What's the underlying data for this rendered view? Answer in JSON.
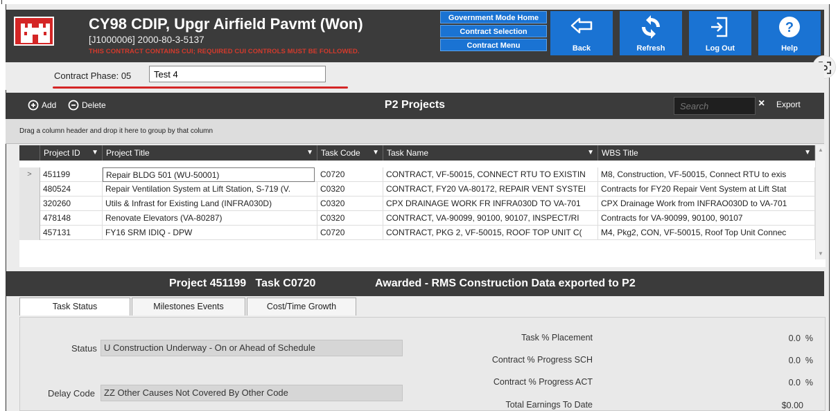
{
  "header": {
    "title": "CY98 CDIP, Upgr Airfield Pavmt (Won)",
    "subtitle": "[J1000006] 2000-80-3-5137",
    "cui_notice": "THIS CONTRACT CONTAINS CUI; REQUIRED CUI CONTROLS MUST BE FOLLOWED.",
    "nav_links": [
      "Government Mode Home",
      "Contract Selection",
      "Contract Menu"
    ],
    "buttons": {
      "back": "Back",
      "refresh": "Refresh",
      "logout": "Log Out",
      "help": "Help"
    },
    "colors": {
      "bg": "#3b3b3b",
      "button": "#1a73d3",
      "logo": "#d42626",
      "cui": "#d33a2c"
    }
  },
  "phase": {
    "label": "Contract Phase: 05",
    "input_value": "Test 4"
  },
  "toolbar": {
    "add": "Add",
    "delete": "Delete",
    "title": "P2 Projects",
    "search_placeholder": "Search",
    "clear": "×",
    "export": "Export"
  },
  "group_hint": "Drag a column header and drop it here to group by that column",
  "grid": {
    "columns": [
      "Project ID",
      "Project Title",
      "Task Code",
      "Task Name",
      "WBS Title"
    ],
    "rows": [
      {
        "id": "451199",
        "title": "Repair BLDG 501 (WU-50001)",
        "code": "C0720",
        "task": "CONTRACT, VF-50015, CONNECT RTU TO EXISTIN",
        "wbs": "M8, Construction, VF-50015, Connect RTU to exis",
        "selector": ">"
      },
      {
        "id": "480524",
        "title": "Repair Ventilation System at Lift Station, S-719 (V.",
        "code": "C0320",
        "task": "CONTRACT, FY20 VA-80172, REPAIR VENT SYSTEI",
        "wbs": "Contracts for FY20 Repair Vent System at Lift Stat",
        "selector": ""
      },
      {
        "id": "320260",
        "title": "Utils & Infrast for Existing Land (INFRA030D)",
        "code": "C0320",
        "task": "CPX DRAINAGE WORK FR INFRA030D TO VA-701",
        "wbs": "CPX Drainage Work from INFRAO030D to VA-701",
        "selector": ""
      },
      {
        "id": "478148",
        "title": "Renovate Elevators (VA-80287)",
        "code": "C0320",
        "task": "CONTRACT, VA-90099, 90100, 90107, INSPECT/RI",
        "wbs": "Contracts for VA-90099, 90100, 90107",
        "selector": ""
      },
      {
        "id": "457131",
        "title": "FY16 SRM IDIQ - DPW",
        "code": "C0720",
        "task": "CONTRACT, PKG 2, VF-50015, ROOF TOP UNIT C(",
        "wbs": "M4, Pkg2, CON, VF-50015, Roof Top Unit Connec",
        "selector": ""
      }
    ]
  },
  "detail": {
    "project": "Project 451199   Task C0720",
    "status_text": "Awarded - RMS Construction Data exported to P2"
  },
  "tabs": [
    "Task Status",
    "Milestones Events",
    "Cost/Time Growth"
  ],
  "status": {
    "status_label": "Status",
    "status_value": "U Construction Underway - On or Ahead of Schedule",
    "delay_label": "Delay Code",
    "delay_value": "ZZ Other Causes Not Covered By Other Code",
    "metrics": [
      {
        "label": "Task % Placement",
        "value": "0.0  %"
      },
      {
        "label": "Contract % Progress SCH",
        "value": "0.0  %"
      },
      {
        "label": "Contract % Progress ACT",
        "value": "0.0  %"
      },
      {
        "label": "Total Earnings To Date",
        "value": "$0.00"
      }
    ]
  }
}
